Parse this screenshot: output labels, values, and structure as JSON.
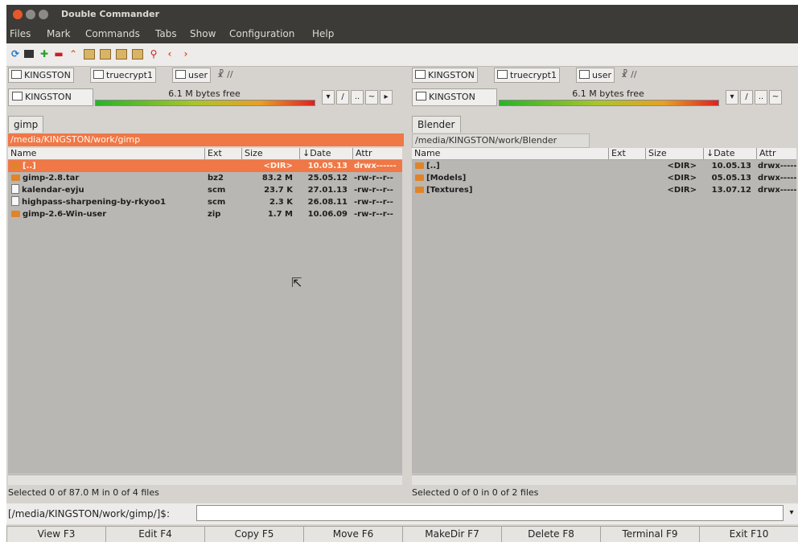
{
  "window": {
    "title": "Double Commander"
  },
  "menu": [
    "Files",
    "Mark",
    "Commands",
    "Tabs",
    "Show",
    "Configuration",
    "Help"
  ],
  "toolbar_icons": [
    "refresh-icon",
    "terminal-icon",
    "add-icon",
    "remove-icon",
    "up-arrow-icon",
    "compare-icon",
    "view-icon",
    "edit-icon",
    "search-icon",
    "back-icon",
    "forward-icon"
  ],
  "drive_extra": "☧ //",
  "left": {
    "drives": [
      "KINGSTON",
      "truecrypt1",
      "user"
    ],
    "volume": "KINGSTON",
    "free": "6.1 M bytes free",
    "free_fraction": 0.7,
    "nav": [
      "/",
      "..",
      "~"
    ],
    "tab": "gimp",
    "path": "/media/KINGSTON/work/gimp",
    "columns": {
      "name": "Name",
      "ext": "Ext",
      "size": "Size",
      "date": "↓Date",
      "attr": "Attr"
    },
    "files": [
      {
        "name": "[..]",
        "ext": "",
        "size": "<DIR>",
        "date": "10.05.13",
        "attr": "drwx------",
        "type": "folder",
        "selected": true
      },
      {
        "name": "gimp-2.8.tar",
        "ext": "bz2",
        "size": "83.2 M",
        "date": "25.05.12",
        "attr": "-rw-r--r--",
        "type": "folder"
      },
      {
        "name": "kalendar-eyju",
        "ext": "scm",
        "size": "23.7 K",
        "date": "27.01.13",
        "attr": "-rw-r--r--",
        "type": "file"
      },
      {
        "name": "highpass-sharpening-by-rkyoo1",
        "ext": "scm",
        "size": "2.3 K",
        "date": "26.08.11",
        "attr": "-rw-r--r--",
        "type": "file"
      },
      {
        "name": "gimp-2.6-Win-user",
        "ext": "zip",
        "size": "1.7 M",
        "date": "10.06.09",
        "attr": "-rw-r--r--",
        "type": "folder"
      }
    ],
    "status": "Selected 0 of 87.0 M in 0 of 4 files"
  },
  "right": {
    "drives": [
      "KINGSTON",
      "truecrypt1",
      "user"
    ],
    "volume": "KINGSTON",
    "free": "6.1 M bytes free",
    "free_fraction": 0.7,
    "nav": [
      "/",
      "..",
      "~"
    ],
    "tab": "Blender",
    "path": "/media/KINGSTON/work/Blender",
    "columns": {
      "name": "Name",
      "ext": "Ext",
      "size": "Size",
      "date": "↓Date",
      "attr": "Attr"
    },
    "files": [
      {
        "name": "[..]",
        "ext": "",
        "size": "<DIR>",
        "date": "10.05.13",
        "attr": "drwx------",
        "type": "folder"
      },
      {
        "name": "[Models]",
        "ext": "",
        "size": "<DIR>",
        "date": "05.05.13",
        "attr": "drwx------",
        "type": "folder"
      },
      {
        "name": "[Textures]",
        "ext": "",
        "size": "<DIR>",
        "date": "13.07.12",
        "attr": "drwx------",
        "type": "folder"
      }
    ],
    "status": "Selected 0 of 0 in 0 of 2 files"
  },
  "command": {
    "prompt": "[/media/KINGSTON/work/gimp/]$:",
    "value": ""
  },
  "fkeys": [
    "View F3",
    "Edit F4",
    "Copy F5",
    "Move F6",
    "MakeDir F7",
    "Delete F8",
    "Terminal F9",
    "Exit F10"
  ]
}
